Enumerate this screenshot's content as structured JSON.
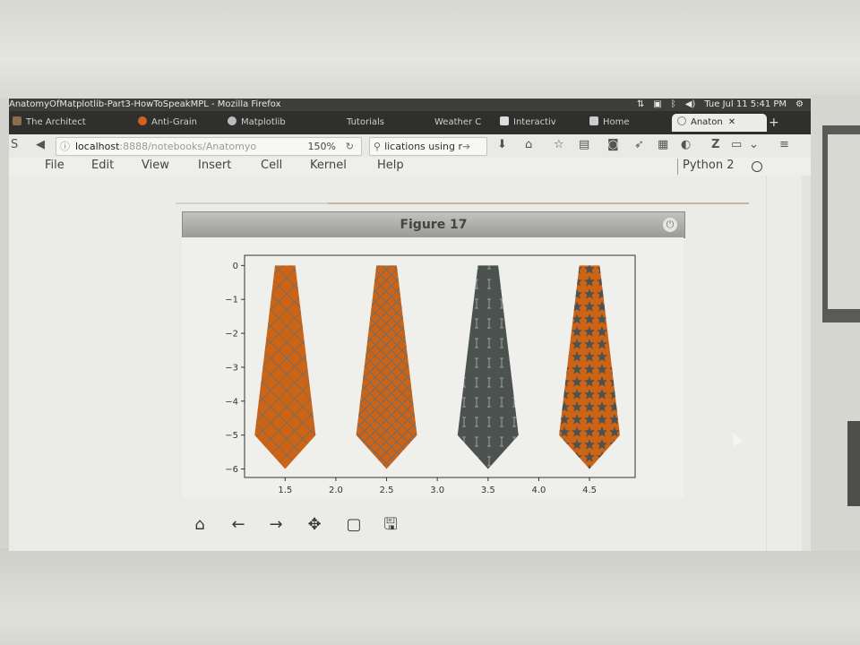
{
  "window": {
    "title": "AnatomyOfMatplotlib-Part3-HowToSpeakMPL - Mozilla Firefox",
    "clock": "Tue Jul 11 5:41 PM"
  },
  "tabs": [
    {
      "label": "The Architect"
    },
    {
      "label": "Anti-Grain"
    },
    {
      "label": "Matplotlib"
    },
    {
      "label": "Tutorials"
    },
    {
      "label": "Weather C"
    },
    {
      "label": "Interactiv"
    },
    {
      "label": "Home"
    },
    {
      "label": "Anaton",
      "active": true
    }
  ],
  "navbar": {
    "host": "localhost",
    "path": ":8888/notebooks/Anatomyo",
    "zoom": "150%",
    "search_text": "lications using r"
  },
  "menubar": {
    "items": [
      "File",
      "Edit",
      "View",
      "Insert",
      "Cell",
      "Kernel",
      "Help"
    ],
    "kernel": "Python 2"
  },
  "figure": {
    "title": "Figure 17"
  },
  "colors": {
    "orange": "#cc6315",
    "gray": "#4b5250",
    "pattern": "#6e6d68"
  },
  "chart_data": {
    "type": "area",
    "title": "",
    "xlabel": "",
    "ylabel": "",
    "xlim": [
      1.1,
      4.95
    ],
    "ylim": [
      -6.25,
      0.3
    ],
    "xticks": [
      "1.5",
      "2.0",
      "2.5",
      "3.0",
      "3.5",
      "4.0",
      "4.5"
    ],
    "xtick_values": [
      1.5,
      2.0,
      2.5,
      3.0,
      3.5,
      4.0,
      4.5
    ],
    "yticks": [
      "0",
      "−1",
      "−2",
      "−3",
      "−4",
      "−5",
      "−6"
    ],
    "ytick_values": [
      0,
      -1,
      -2,
      -3,
      -4,
      -5,
      -6
    ],
    "grid": false,
    "series": [
      {
        "center": 1.5,
        "fill": "#cc6315",
        "hatch": "x"
      },
      {
        "center": 2.5,
        "fill": "#cc6315",
        "hatch": "xx"
      },
      {
        "center": 3.5,
        "fill": "#4b5250",
        "hatch": "I"
      },
      {
        "center": 4.5,
        "fill": "#cc6315",
        "hatch": "*"
      }
    ],
    "tie_shape": [
      [
        -0.1,
        0
      ],
      [
        0.1,
        0
      ],
      [
        0.3,
        -5
      ],
      [
        0,
        -6
      ],
      [
        -0.3,
        -5
      ]
    ]
  }
}
